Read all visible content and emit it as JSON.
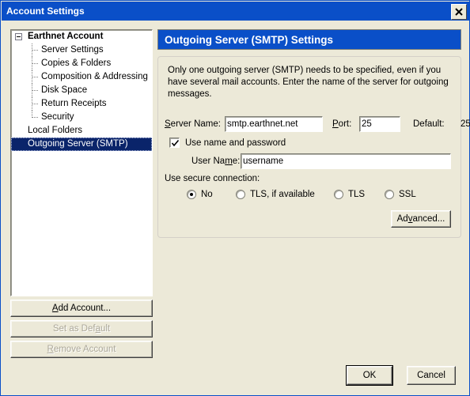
{
  "window": {
    "title": "Account Settings",
    "close_icon": "close-icon",
    "titlebar_color": "#0a4fc8",
    "background_color": "#ece9d8"
  },
  "tree": {
    "items": [
      {
        "label": "Earthnet Account",
        "level": "root",
        "selected": false,
        "expanded": true
      },
      {
        "label": "Server Settings",
        "level": "child",
        "selected": false
      },
      {
        "label": "Copies & Folders",
        "level": "child",
        "selected": false
      },
      {
        "label": "Composition & Addressing",
        "level": "child",
        "selected": false
      },
      {
        "label": "Disk Space",
        "level": "child",
        "selected": false
      },
      {
        "label": "Return Receipts",
        "level": "child",
        "selected": false
      },
      {
        "label": "Security",
        "level": "child",
        "selected": false
      },
      {
        "label": "Local Folders",
        "level": "toplevel",
        "selected": false
      },
      {
        "label": "Outgoing Server (SMTP)",
        "level": "toplevel",
        "selected": true
      }
    ]
  },
  "account_buttons": {
    "add": "Add Account...",
    "set_default": "Set as Default",
    "remove": "Remove Account",
    "add_enabled": true,
    "set_default_enabled": false,
    "remove_enabled": false
  },
  "panel": {
    "header": "Outgoing Server (SMTP) Settings",
    "description": "Only one outgoing server (SMTP) needs to be specified, even if you have several mail accounts. Enter the name of the server for outgoing messages.",
    "server_name_label": "Server Name:",
    "server_name_value": "smtp.earthnet.net",
    "port_label": "Port:",
    "port_value": "25",
    "default_label": "Default:",
    "default_value": "25",
    "use_name_password_label": "Use name and password",
    "use_name_password_checked": true,
    "user_name_label": "User Name:",
    "user_name_value": "username",
    "secure_connection_label": "Use secure connection:",
    "secure_options": [
      {
        "label": "No",
        "selected": true
      },
      {
        "label": "TLS, if available",
        "selected": false
      },
      {
        "label": "TLS",
        "selected": false
      },
      {
        "label": "SSL",
        "selected": false
      }
    ],
    "advanced_button": "Advanced..."
  },
  "dialog_buttons": {
    "ok": "OK",
    "cancel": "Cancel"
  }
}
